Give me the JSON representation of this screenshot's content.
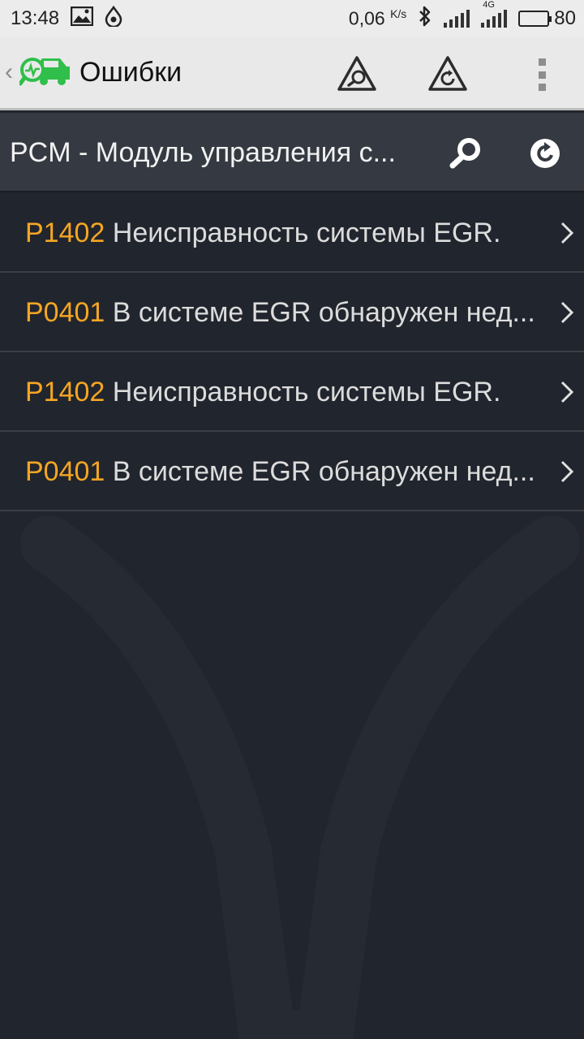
{
  "status_bar": {
    "time": "13:48",
    "net_speed": "0,06",
    "net_unit": "K/s",
    "network_type": "4G",
    "battery": "80"
  },
  "toolbar": {
    "title": "Ошибки",
    "icons": [
      "back-chevron-icon",
      "app-logo-icon",
      "scan-warning-icon",
      "refresh-warning-icon",
      "overflow-menu-icon"
    ]
  },
  "module": {
    "title": "PCM - Модуль управления с...",
    "icons": [
      "search-icon",
      "refresh-icon"
    ]
  },
  "errors": [
    {
      "code": "P1402",
      "description": "Неисправность системы EGR."
    },
    {
      "code": "P0401",
      "description": "В системе EGR обнаружен нед..."
    },
    {
      "code": "P1402",
      "description": "Неисправность системы EGR."
    },
    {
      "code": "P0401",
      "description": "В системе EGR обнаружен нед..."
    }
  ],
  "colors": {
    "accent_code": "#f5a623",
    "logo_green": "#2fbf4a",
    "background": "#21252d",
    "module_bar": "#353a42"
  }
}
